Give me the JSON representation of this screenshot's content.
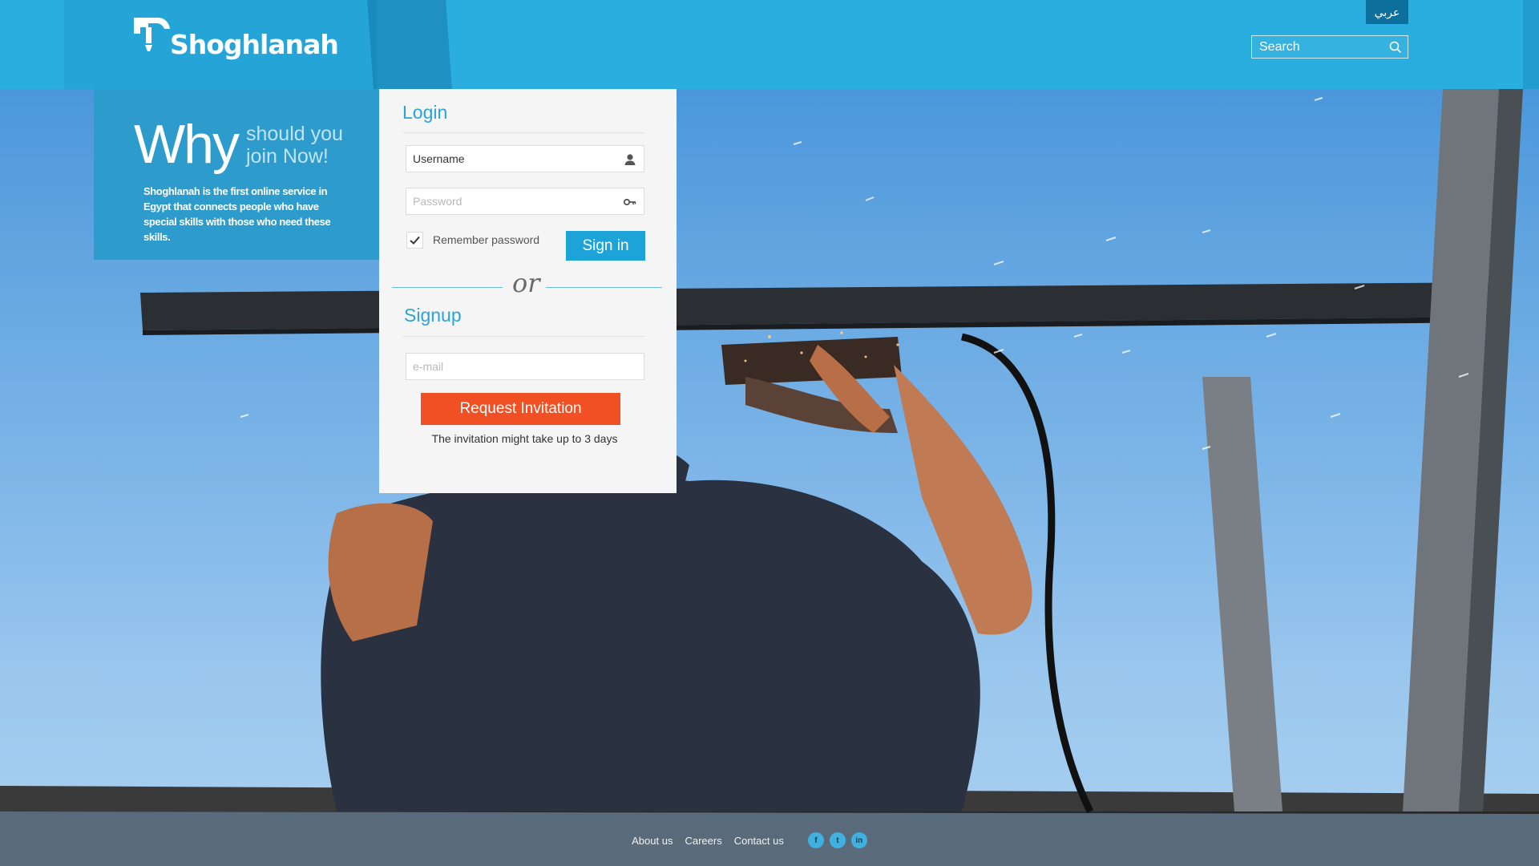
{
  "header": {
    "brand": "Shoghlanah",
    "lang_label": "عربي",
    "search_placeholder": "Search"
  },
  "why": {
    "big": "Why",
    "small": "should you join Now!",
    "description": "Shoghlanah is the first online service in Egypt that connects people who have special skills with those who need these skills."
  },
  "login": {
    "title": "Login",
    "username_placeholder": "Username",
    "password_placeholder": "Password",
    "remember_label": "Remember password",
    "remember_checked": true,
    "signin_label": "Sign in"
  },
  "divider": {
    "text": "or"
  },
  "signup": {
    "title": "Signup",
    "email_placeholder": "e-mail",
    "request_label": "Request Invitation",
    "note": "The invitation might take up  to 3 days"
  },
  "footer": {
    "links": [
      "About us",
      "Careers",
      "Contact us"
    ],
    "social": [
      {
        "icon": "facebook-icon",
        "glyph": "f"
      },
      {
        "icon": "twitter-icon",
        "glyph": "t"
      },
      {
        "icon": "linkedin-icon",
        "glyph": "in"
      }
    ]
  },
  "colors": {
    "header": "#2aaee0",
    "panel": "#2d9ccd",
    "accent": "#1ea3d8",
    "cta": "#f05023"
  }
}
